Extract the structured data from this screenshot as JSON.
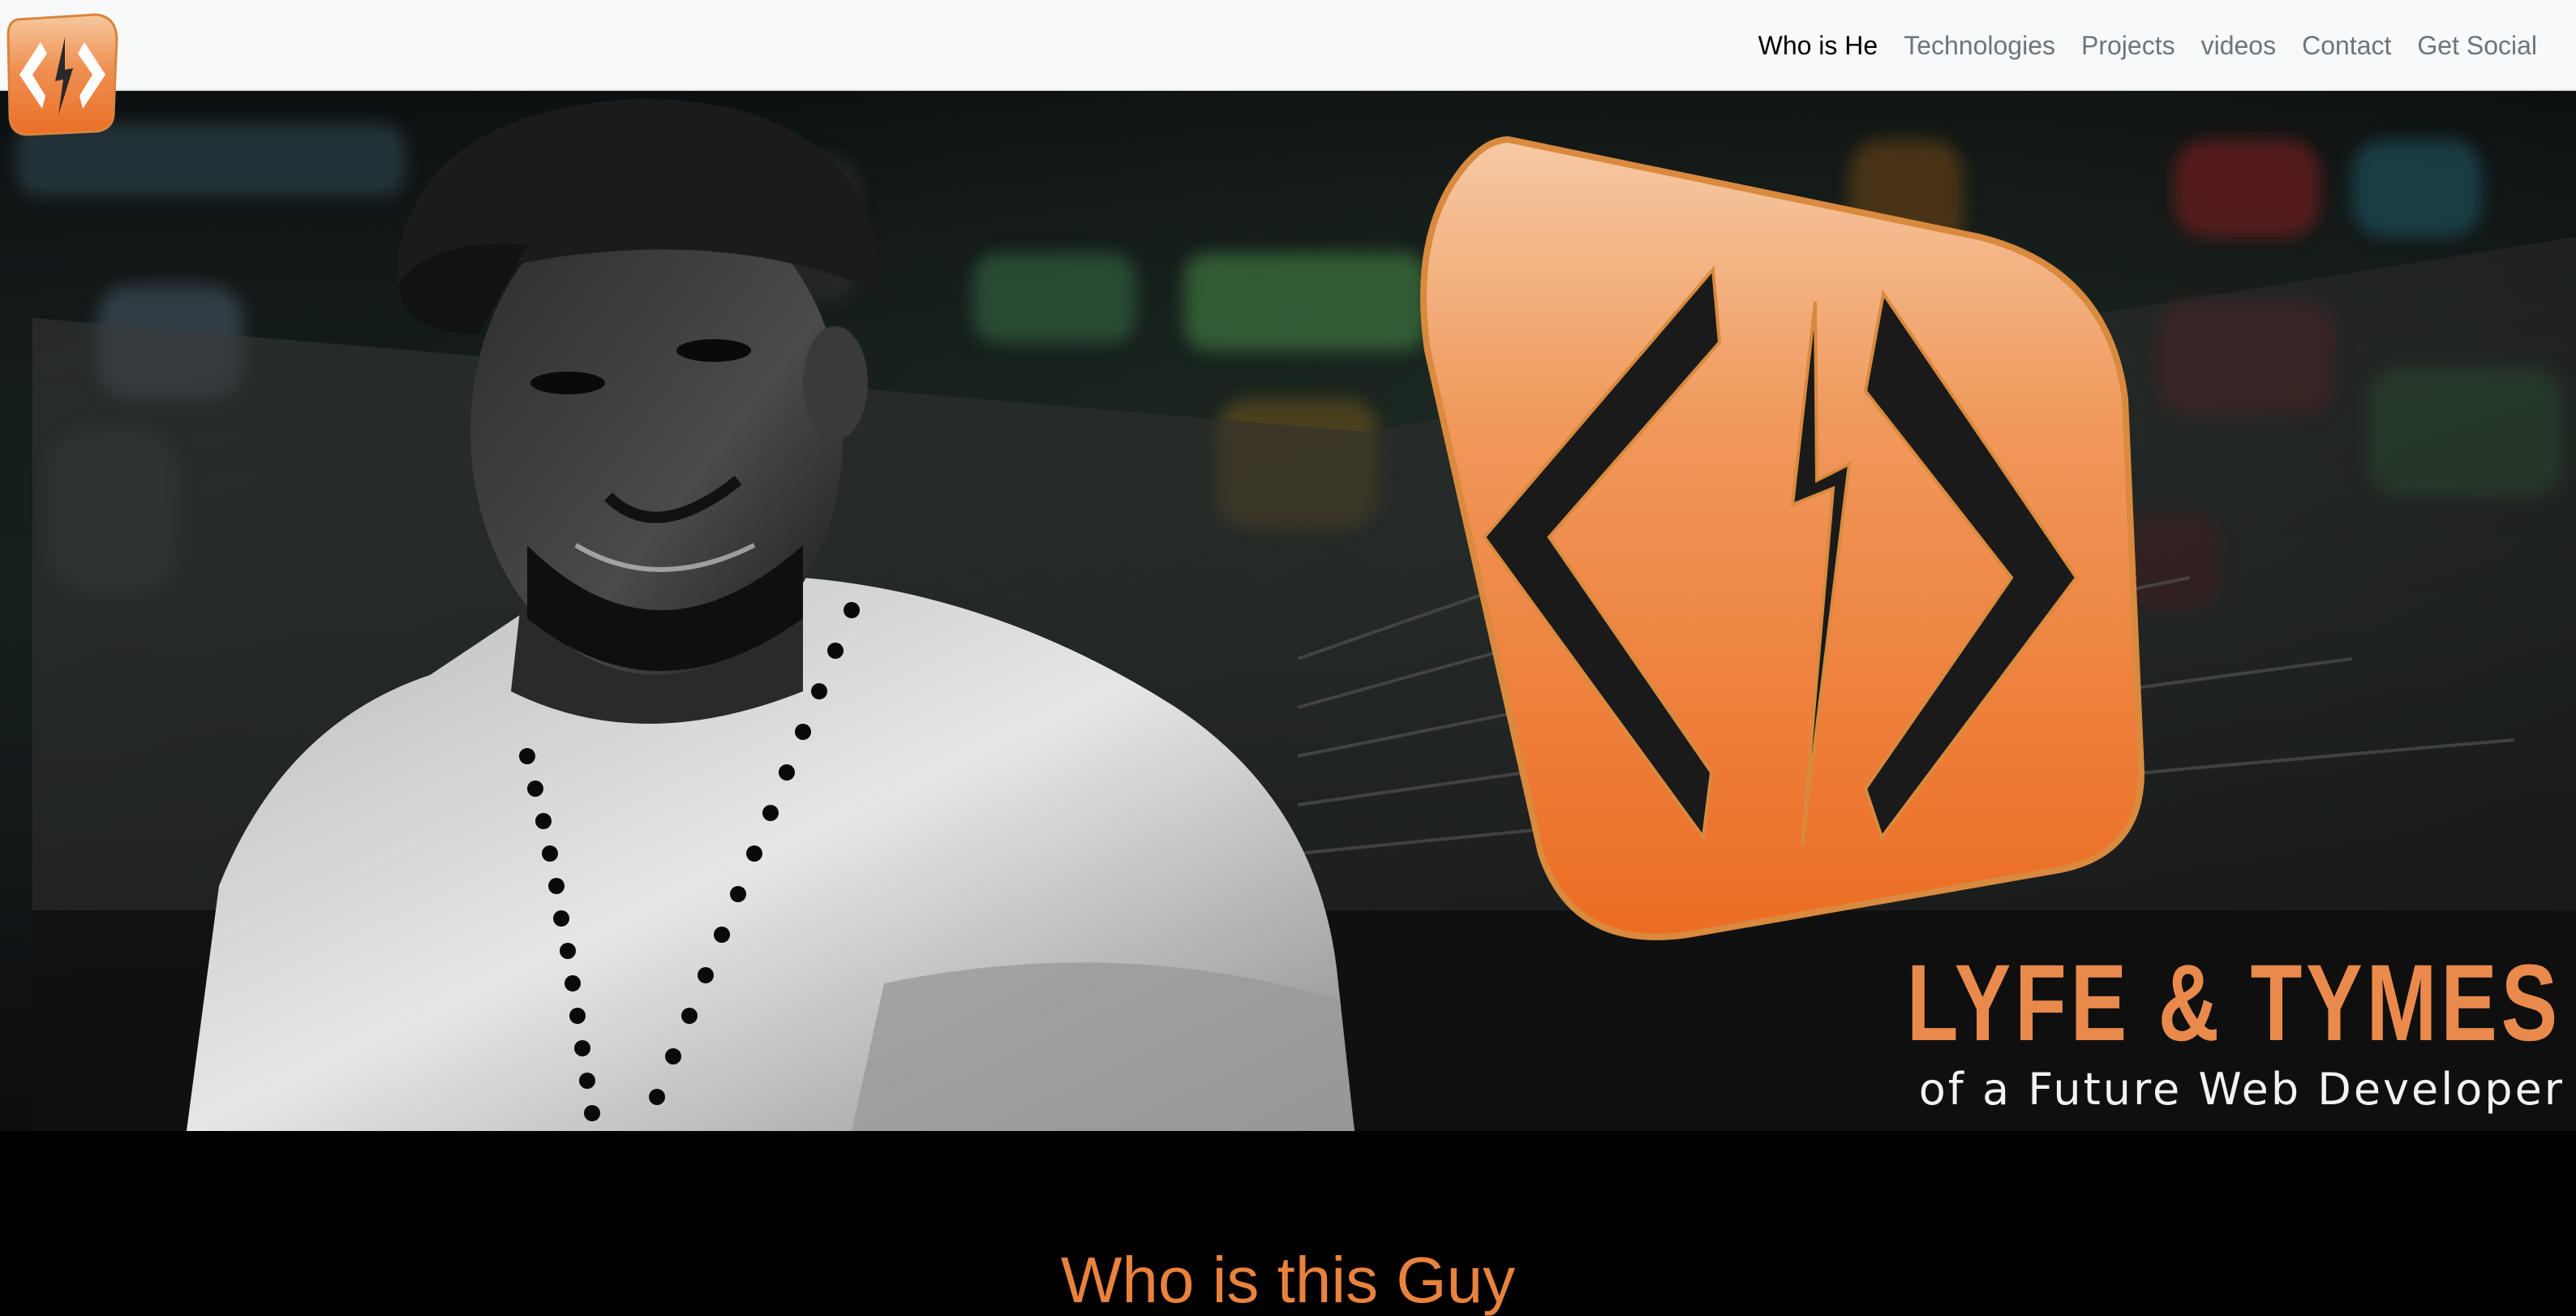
{
  "navbar": {
    "brand_icon": "code-bolt-logo-icon",
    "links": [
      {
        "label": "Who is He",
        "active": true
      },
      {
        "label": "Technologies",
        "active": false
      },
      {
        "label": "Projects",
        "active": false
      },
      {
        "label": "videos",
        "active": false
      },
      {
        "label": "Contact",
        "active": false
      },
      {
        "label": "Get Social",
        "active": false
      }
    ]
  },
  "hero": {
    "title": "LYFE & TYMES",
    "subtitle": "of a Future Web Developer",
    "logo_icon": "code-bolt-logo-icon",
    "accent_color": "#ef7a2e"
  },
  "section": {
    "heading": "Who is this Guy"
  }
}
